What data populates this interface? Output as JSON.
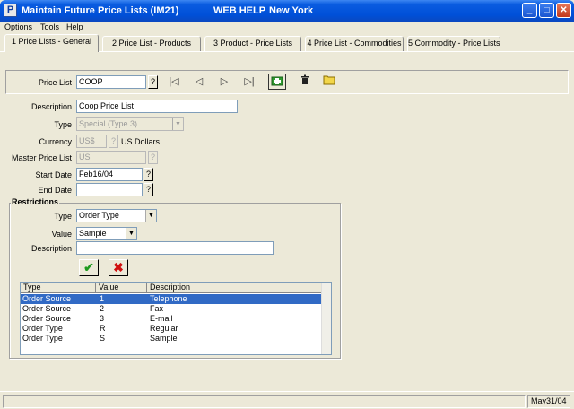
{
  "window": {
    "app_icon": "P",
    "title": "Maintain Future Price Lists (IM21)",
    "web_help": "WEB HELP",
    "location": "New York",
    "controls": [
      "minimize-icon",
      "maximize-icon",
      "close-icon"
    ]
  },
  "menu": [
    "Options",
    "Tools",
    "Help"
  ],
  "tabs": [
    {
      "label": "1 Price Lists - General",
      "active": true
    },
    {
      "label": "2 Price List - Products",
      "active": false
    },
    {
      "label": "3 Product - Price Lists",
      "active": false
    },
    {
      "label": "4 Price List - Commodities",
      "active": false
    },
    {
      "label": "5 Commodity - Price Lists",
      "active": false
    }
  ],
  "header": {
    "price_list_label": "Price List",
    "price_list_value": "COOP",
    "lookup": "?"
  },
  "form": {
    "description_label": "Description",
    "description_value": "Coop Price List",
    "type_label": "Type",
    "type_value": "Special  (Type 3)",
    "currency_label": "Currency",
    "currency_value": "US$",
    "currency_name": "US Dollars",
    "master_label": "Master Price List",
    "master_value": "US",
    "start_label": "Start Date",
    "start_value": "Feb16/04",
    "end_label": "End Date",
    "end_value": ""
  },
  "restrictions": {
    "title": "Restrictions",
    "type_label": "Type",
    "type_value": "Order Type",
    "value_label": "Value",
    "value_value": "Sample",
    "description_label": "Description",
    "description_value": "",
    "columns": [
      "Type",
      "Value",
      "Description"
    ],
    "rows": [
      [
        "Order Source",
        "1",
        "Telephone"
      ],
      [
        "Order Source",
        "2",
        "Fax"
      ],
      [
        "Order Source",
        "3",
        "E-mail"
      ],
      [
        "Order Type",
        "R",
        "Regular"
      ],
      [
        "Order Type",
        "S",
        "Sample"
      ]
    ],
    "selected_row": 0
  },
  "status": {
    "date": "May31/04"
  },
  "colors": {
    "title_blue": "#0050d8",
    "selection": "#316ac5",
    "window_bg": "#ece9d8"
  }
}
